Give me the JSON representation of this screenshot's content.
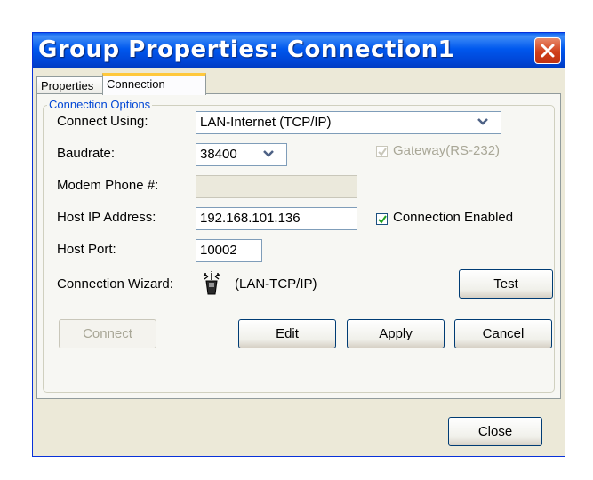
{
  "window": {
    "title": "Group Properties: Connection1"
  },
  "tabs": [
    {
      "label": "Properties",
      "active": false
    },
    {
      "label": "Connection",
      "active": true
    }
  ],
  "connection_options": {
    "group_label": "Connection Options",
    "connect_using": {
      "label": "Connect Using:",
      "value": "LAN-Internet (TCP/IP)"
    },
    "baudrate": {
      "label": "Baudrate:",
      "value": "38400"
    },
    "gateway": {
      "label": "Gateway(RS-232)",
      "checked": true,
      "enabled": false
    },
    "modem_phone": {
      "label": "Modem Phone #:",
      "value": ""
    },
    "host_ip": {
      "label": "Host IP Address:",
      "value": "192.168.101.136"
    },
    "connection_enabled": {
      "label": "Connection Enabled",
      "checked": true
    },
    "host_port": {
      "label": "Host Port:",
      "value": "10002"
    },
    "wizard": {
      "label": "Connection Wizard:",
      "value": "(LAN-TCP/IP)",
      "icon": "wizard-wand-icon"
    }
  },
  "buttons": {
    "test": "Test",
    "connect": "Connect",
    "edit": "Edit",
    "apply": "Apply",
    "cancel": "Cancel",
    "close": "Close"
  },
  "colors": {
    "titlebar": "#0058ee",
    "group_label": "#0046d5",
    "close_button": "#d0401b",
    "dialog_bg": "#ece9d8"
  }
}
